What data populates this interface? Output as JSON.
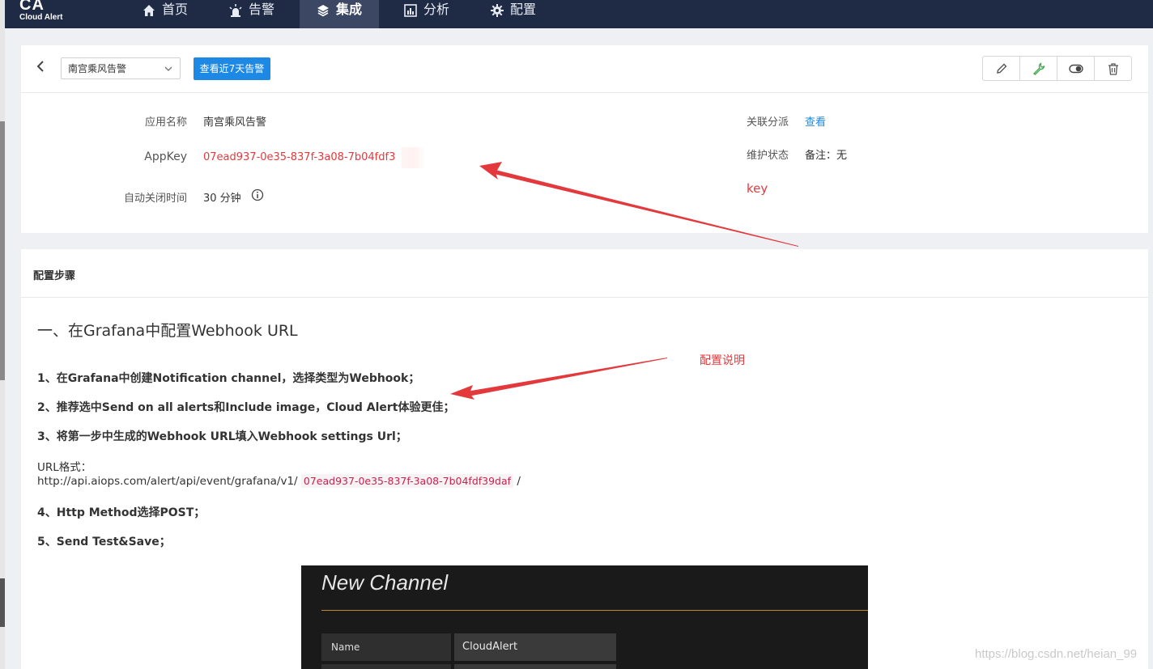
{
  "nav": {
    "logo_big": "CA",
    "logo_small": "Cloud Alert",
    "items": [
      {
        "label": "首页",
        "icon": "home-icon"
      },
      {
        "label": "告警",
        "icon": "alarm-light-icon"
      },
      {
        "label": "集成",
        "icon": "layers-icon"
      },
      {
        "label": "分析",
        "icon": "bar-chart-icon"
      },
      {
        "label": "配置",
        "icon": "gear-icon"
      }
    ],
    "active": "集成"
  },
  "header": {
    "app_select_value": "南宫乘风告警",
    "recent_button": "查看近7天告警",
    "tools": [
      "edit-icon",
      "wrench-icon",
      "toggle-icon",
      "trash-icon"
    ]
  },
  "info": {
    "app_name_label": "应用名称",
    "app_name_value": "南宫乘风告警",
    "appkey_label": "AppKey",
    "appkey_value": "07ead937-0e35-837f-3a08-7b04fdf3",
    "autoclose_label": "自动关闭时间",
    "autoclose_value": "30 分钟",
    "dispatch_label": "关联分派",
    "dispatch_link": "查看",
    "maint_label": "维护状态",
    "maint_value": "备注：无"
  },
  "steps": {
    "header": "配置步骤",
    "section_title": "一、在Grafana中配置Webhook URL",
    "s1": "1、在Grafana中创建Notification channel，选择类型为Webhook；",
    "s2": "2、推荐选中Send on all alerts和Include image，Cloud Alert体验更佳；",
    "s3": "3、将第一步中生成的Webhook URL填入Webhook settings Url；",
    "url_label": "URL格式：",
    "url_prefix": "http://api.aiops.com/alert/api/event/grafana/v1/",
    "url_key": "07ead937-0e35-837f-3a08-7b04fdf39daf",
    "url_suffix": "/",
    "s4": "4、Http Method选择POST；",
    "s5": "5、Send Test&Save；"
  },
  "grafana": {
    "title": "New Channel",
    "name_label": "Name",
    "name_value": "CloudAlert"
  },
  "annotations": {
    "key_note": "key",
    "config_note": "配置说明",
    "watermark": "https://blog.csdn.net/heian_99"
  },
  "colors": {
    "nav_bg": "#1f2a44",
    "accent": "#1e88e5",
    "key_red": "#e4393c",
    "code_red": "#c7254e"
  }
}
